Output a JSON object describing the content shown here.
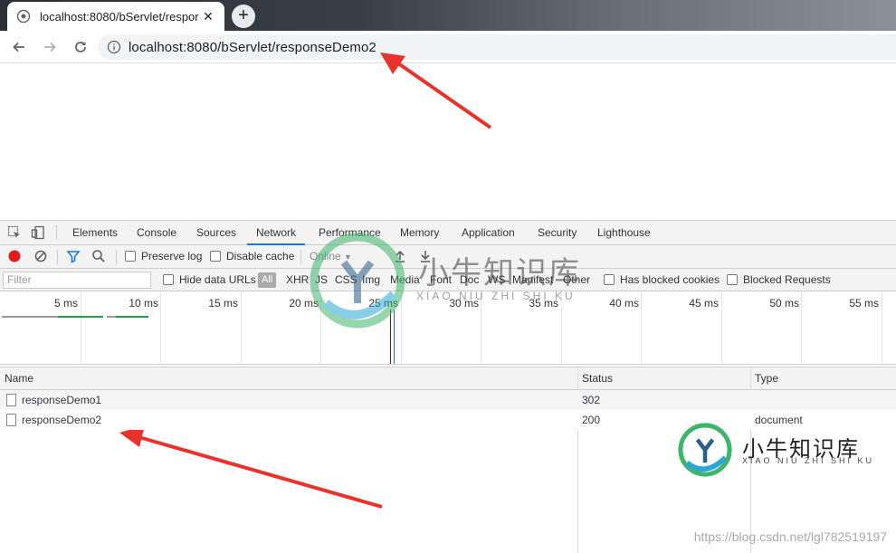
{
  "browser": {
    "tab_title": "localhost:8080/bServlet/respor",
    "tab_close": "✕",
    "new_tab": "+",
    "url": "localhost:8080/bServlet/responseDemo2"
  },
  "devtools": {
    "tabs": [
      "Elements",
      "Console",
      "Sources",
      "Network",
      "Performance",
      "Memory",
      "Application",
      "Security",
      "Lighthouse"
    ],
    "active_tab": "Network",
    "toolbar": {
      "preserve_log": "Preserve log",
      "disable_cache": "Disable cache",
      "throttle": "Online"
    },
    "filter": {
      "placeholder": "Filter",
      "hide_data_urls": "Hide data URLs",
      "all": "All",
      "types": [
        "XHR",
        "JS",
        "CSS",
        "Img",
        "Media",
        "Font",
        "Doc",
        "WS",
        "Manifest",
        "Other"
      ],
      "has_blocked_cookies": "Has blocked cookies",
      "blocked_requests": "Blocked Requests"
    },
    "timeline_ticks": [
      "5 ms",
      "10 ms",
      "15 ms",
      "20 ms",
      "25 ms",
      "30 ms",
      "35 ms",
      "40 ms",
      "45 ms",
      "50 ms",
      "55 ms"
    ],
    "columns": {
      "name": "Name",
      "status": "Status",
      "type": "Type"
    },
    "rows": [
      {
        "name": "responseDemo1",
        "status": "302",
        "type": ""
      },
      {
        "name": "responseDemo2",
        "status": "200",
        "type": "document"
      }
    ]
  },
  "watermark": {
    "brand": "小牛知识库",
    "pinyin": "XIAO NIU ZHI SHI KU",
    "credit": "https://blog.csdn.net/lgl782519197"
  },
  "colors": {
    "accent": "#1a73e8",
    "record": "#e21b1b",
    "arrow": "#e8322b"
  }
}
